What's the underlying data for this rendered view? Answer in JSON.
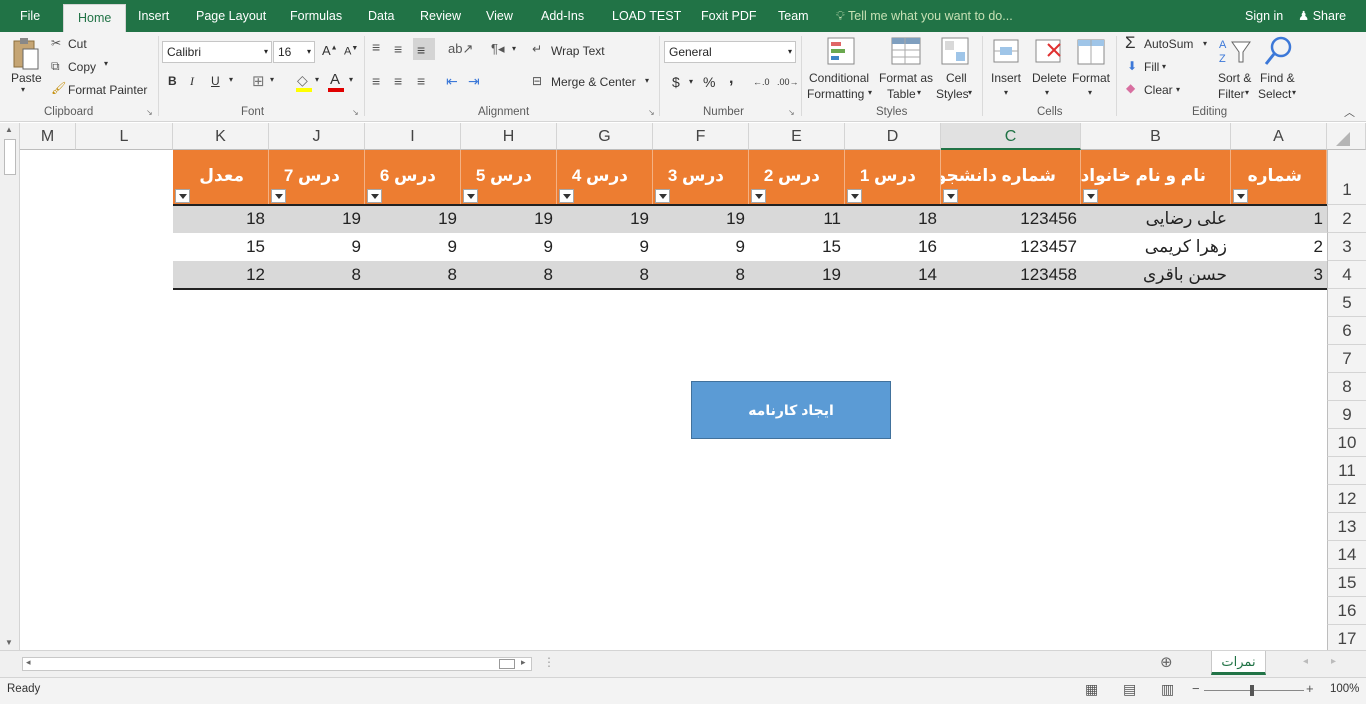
{
  "tabs": {
    "file": "File",
    "home": "Home",
    "insert": "Insert",
    "page_layout": "Page Layout",
    "formulas": "Formulas",
    "data": "Data",
    "review": "Review",
    "view": "View",
    "add_ins": "Add-Ins",
    "load_test": "LOAD TEST",
    "foxit": "Foxit PDF",
    "team": "Team"
  },
  "tellme": "Tell me what you want to do...",
  "signin": "Sign in",
  "share": "Share",
  "clipboard": {
    "paste": "Paste",
    "cut": "Cut",
    "copy": "Copy",
    "format_painter": "Format Painter",
    "label": "Clipboard"
  },
  "font": {
    "name": "Calibri",
    "size": "16",
    "bold": "B",
    "italic": "I",
    "underline": "U",
    "label": "Font"
  },
  "alignment": {
    "wrap": "Wrap Text",
    "merge": "Merge & Center",
    "label": "Alignment"
  },
  "number": {
    "format": "General",
    "currency": "$",
    "percent": "%",
    "comma": ",",
    "label": "Number"
  },
  "styles": {
    "conditional": "Conditional",
    "conditional2": "Formatting",
    "format_table": "Format as",
    "format_table2": "Table",
    "cell_styles": "Cell",
    "cell_styles2": "Styles",
    "label": "Styles"
  },
  "cells": {
    "insert": "Insert",
    "delete": "Delete",
    "format": "Format",
    "label": "Cells"
  },
  "editing": {
    "autosum": "AutoSum",
    "fill": "Fill",
    "clear": "Clear",
    "sort": "Sort &",
    "sort2": "Filter",
    "find": "Find &",
    "find2": "Select",
    "label": "Editing"
  },
  "columns": [
    "M",
    "L",
    "K",
    "J",
    "I",
    "H",
    "G",
    "F",
    "E",
    "D",
    "C",
    "B",
    "A"
  ],
  "rows": [
    "1",
    "2",
    "3",
    "4",
    "5",
    "6",
    "7",
    "8",
    "9",
    "10",
    "11",
    "12",
    "13",
    "14",
    "15",
    "16",
    "17"
  ],
  "table": {
    "headers": [
      "معدل",
      "درس 7",
      "درس 6",
      "درس 5",
      "درس 4",
      "درس 3",
      "درس 2",
      "درس 1",
      "شماره دانشجویی",
      "نام و نام خانوادگی",
      "شماره"
    ],
    "rows": [
      [
        "18",
        "19",
        "19",
        "19",
        "19",
        "19",
        "11",
        "18",
        "123456",
        "علی رضایی",
        "1"
      ],
      [
        "15",
        "9",
        "9",
        "9",
        "9",
        "9",
        "15",
        "16",
        "123457",
        "زهرا کریمی",
        "2"
      ],
      [
        "12",
        "8",
        "8",
        "8",
        "8",
        "8",
        "19",
        "14",
        "123458",
        "حسن باقری",
        "3"
      ]
    ]
  },
  "button_label": "ایجاد کارنامه",
  "sheet_tab": "نمرات",
  "status": {
    "ready": "Ready",
    "zoom": "100%"
  },
  "colors": {
    "excel_green": "#217346",
    "header_orange": "#ed7d31",
    "band_gray": "#d9d9d9",
    "button_blue": "#5b9bd5"
  }
}
